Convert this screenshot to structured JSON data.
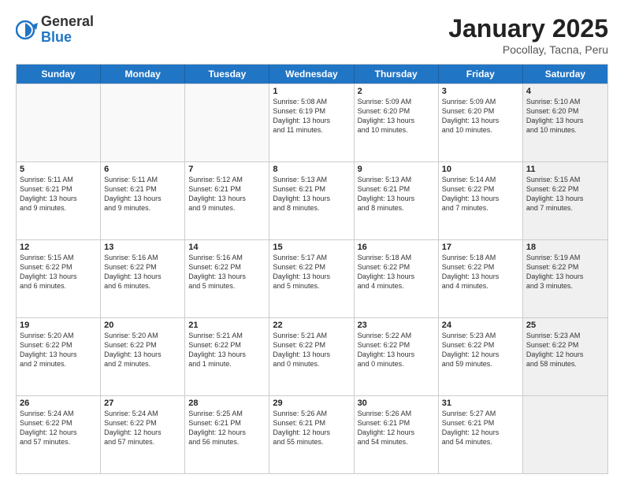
{
  "logo": {
    "general": "General",
    "blue": "Blue"
  },
  "title": "January 2025",
  "subtitle": "Pocollay, Tacna, Peru",
  "headers": [
    "Sunday",
    "Monday",
    "Tuesday",
    "Wednesday",
    "Thursday",
    "Friday",
    "Saturday"
  ],
  "rows": [
    [
      {
        "day": "",
        "lines": [],
        "empty": true
      },
      {
        "day": "",
        "lines": [],
        "empty": true
      },
      {
        "day": "",
        "lines": [],
        "empty": true
      },
      {
        "day": "1",
        "lines": [
          "Sunrise: 5:08 AM",
          "Sunset: 6:19 PM",
          "Daylight: 13 hours",
          "and 11 minutes."
        ],
        "empty": false
      },
      {
        "day": "2",
        "lines": [
          "Sunrise: 5:09 AM",
          "Sunset: 6:20 PM",
          "Daylight: 13 hours",
          "and 10 minutes."
        ],
        "empty": false
      },
      {
        "day": "3",
        "lines": [
          "Sunrise: 5:09 AM",
          "Sunset: 6:20 PM",
          "Daylight: 13 hours",
          "and 10 minutes."
        ],
        "empty": false
      },
      {
        "day": "4",
        "lines": [
          "Sunrise: 5:10 AM",
          "Sunset: 6:20 PM",
          "Daylight: 13 hours",
          "and 10 minutes."
        ],
        "empty": false,
        "shaded": true
      }
    ],
    [
      {
        "day": "5",
        "lines": [
          "Sunrise: 5:11 AM",
          "Sunset: 6:21 PM",
          "Daylight: 13 hours",
          "and 9 minutes."
        ],
        "empty": false
      },
      {
        "day": "6",
        "lines": [
          "Sunrise: 5:11 AM",
          "Sunset: 6:21 PM",
          "Daylight: 13 hours",
          "and 9 minutes."
        ],
        "empty": false
      },
      {
        "day": "7",
        "lines": [
          "Sunrise: 5:12 AM",
          "Sunset: 6:21 PM",
          "Daylight: 13 hours",
          "and 9 minutes."
        ],
        "empty": false
      },
      {
        "day": "8",
        "lines": [
          "Sunrise: 5:13 AM",
          "Sunset: 6:21 PM",
          "Daylight: 13 hours",
          "and 8 minutes."
        ],
        "empty": false
      },
      {
        "day": "9",
        "lines": [
          "Sunrise: 5:13 AM",
          "Sunset: 6:21 PM",
          "Daylight: 13 hours",
          "and 8 minutes."
        ],
        "empty": false
      },
      {
        "day": "10",
        "lines": [
          "Sunrise: 5:14 AM",
          "Sunset: 6:22 PM",
          "Daylight: 13 hours",
          "and 7 minutes."
        ],
        "empty": false
      },
      {
        "day": "11",
        "lines": [
          "Sunrise: 5:15 AM",
          "Sunset: 6:22 PM",
          "Daylight: 13 hours",
          "and 7 minutes."
        ],
        "empty": false,
        "shaded": true
      }
    ],
    [
      {
        "day": "12",
        "lines": [
          "Sunrise: 5:15 AM",
          "Sunset: 6:22 PM",
          "Daylight: 13 hours",
          "and 6 minutes."
        ],
        "empty": false
      },
      {
        "day": "13",
        "lines": [
          "Sunrise: 5:16 AM",
          "Sunset: 6:22 PM",
          "Daylight: 13 hours",
          "and 6 minutes."
        ],
        "empty": false
      },
      {
        "day": "14",
        "lines": [
          "Sunrise: 5:16 AM",
          "Sunset: 6:22 PM",
          "Daylight: 13 hours",
          "and 5 minutes."
        ],
        "empty": false
      },
      {
        "day": "15",
        "lines": [
          "Sunrise: 5:17 AM",
          "Sunset: 6:22 PM",
          "Daylight: 13 hours",
          "and 5 minutes."
        ],
        "empty": false
      },
      {
        "day": "16",
        "lines": [
          "Sunrise: 5:18 AM",
          "Sunset: 6:22 PM",
          "Daylight: 13 hours",
          "and 4 minutes."
        ],
        "empty": false
      },
      {
        "day": "17",
        "lines": [
          "Sunrise: 5:18 AM",
          "Sunset: 6:22 PM",
          "Daylight: 13 hours",
          "and 4 minutes."
        ],
        "empty": false
      },
      {
        "day": "18",
        "lines": [
          "Sunrise: 5:19 AM",
          "Sunset: 6:22 PM",
          "Daylight: 13 hours",
          "and 3 minutes."
        ],
        "empty": false,
        "shaded": true
      }
    ],
    [
      {
        "day": "19",
        "lines": [
          "Sunrise: 5:20 AM",
          "Sunset: 6:22 PM",
          "Daylight: 13 hours",
          "and 2 minutes."
        ],
        "empty": false
      },
      {
        "day": "20",
        "lines": [
          "Sunrise: 5:20 AM",
          "Sunset: 6:22 PM",
          "Daylight: 13 hours",
          "and 2 minutes."
        ],
        "empty": false
      },
      {
        "day": "21",
        "lines": [
          "Sunrise: 5:21 AM",
          "Sunset: 6:22 PM",
          "Daylight: 13 hours",
          "and 1 minute."
        ],
        "empty": false
      },
      {
        "day": "22",
        "lines": [
          "Sunrise: 5:21 AM",
          "Sunset: 6:22 PM",
          "Daylight: 13 hours",
          "and 0 minutes."
        ],
        "empty": false
      },
      {
        "day": "23",
        "lines": [
          "Sunrise: 5:22 AM",
          "Sunset: 6:22 PM",
          "Daylight: 13 hours",
          "and 0 minutes."
        ],
        "empty": false
      },
      {
        "day": "24",
        "lines": [
          "Sunrise: 5:23 AM",
          "Sunset: 6:22 PM",
          "Daylight: 12 hours",
          "and 59 minutes."
        ],
        "empty": false
      },
      {
        "day": "25",
        "lines": [
          "Sunrise: 5:23 AM",
          "Sunset: 6:22 PM",
          "Daylight: 12 hours",
          "and 58 minutes."
        ],
        "empty": false,
        "shaded": true
      }
    ],
    [
      {
        "day": "26",
        "lines": [
          "Sunrise: 5:24 AM",
          "Sunset: 6:22 PM",
          "Daylight: 12 hours",
          "and 57 minutes."
        ],
        "empty": false
      },
      {
        "day": "27",
        "lines": [
          "Sunrise: 5:24 AM",
          "Sunset: 6:22 PM",
          "Daylight: 12 hours",
          "and 57 minutes."
        ],
        "empty": false
      },
      {
        "day": "28",
        "lines": [
          "Sunrise: 5:25 AM",
          "Sunset: 6:21 PM",
          "Daylight: 12 hours",
          "and 56 minutes."
        ],
        "empty": false
      },
      {
        "day": "29",
        "lines": [
          "Sunrise: 5:26 AM",
          "Sunset: 6:21 PM",
          "Daylight: 12 hours",
          "and 55 minutes."
        ],
        "empty": false
      },
      {
        "day": "30",
        "lines": [
          "Sunrise: 5:26 AM",
          "Sunset: 6:21 PM",
          "Daylight: 12 hours",
          "and 54 minutes."
        ],
        "empty": false
      },
      {
        "day": "31",
        "lines": [
          "Sunrise: 5:27 AM",
          "Sunset: 6:21 PM",
          "Daylight: 12 hours",
          "and 54 minutes."
        ],
        "empty": false
      },
      {
        "day": "",
        "lines": [],
        "empty": true,
        "shaded": true
      }
    ]
  ]
}
